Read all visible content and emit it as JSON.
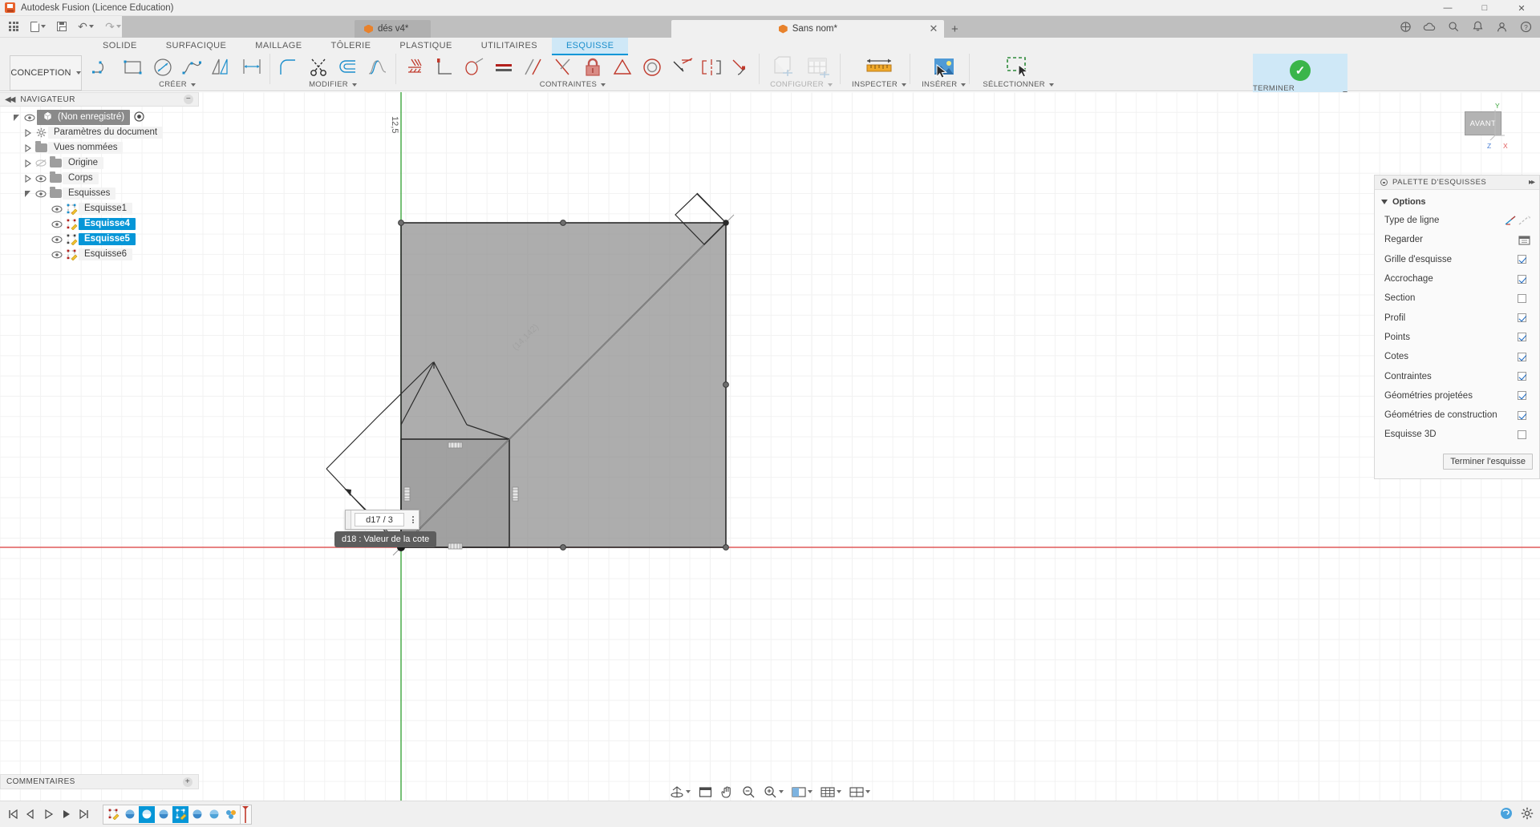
{
  "window": {
    "title": "Autodesk Fusion (Licence Education)",
    "minimize": "—",
    "maximize": "□",
    "close": "✕"
  },
  "quick_access": {
    "grid_icon": "app-grid-icon",
    "new_icon": "new-document-icon",
    "save_icon": "save-icon",
    "undo_icon": "undo-icon",
    "redo_icon": "redo-icon",
    "tabs": [
      {
        "label": "dés v4*",
        "active": false,
        "close": ""
      },
      {
        "label": "Sans nom*",
        "active": true,
        "close": "✕"
      }
    ],
    "new_tab": "+",
    "right_icons": [
      "extensions-icon",
      "cloud-icon",
      "help-search-icon",
      "notifications-icon",
      "account-icon",
      "help-icon"
    ],
    "notification_badge": ""
  },
  "ribbon": {
    "design_dropdown": "CONCEPTION",
    "tabs": [
      {
        "label": "SOLIDE",
        "active": false
      },
      {
        "label": "SURFACIQUE",
        "active": false
      },
      {
        "label": "MAILLAGE",
        "active": false
      },
      {
        "label": "TÔLERIE",
        "active": false
      },
      {
        "label": "PLASTIQUE",
        "active": false
      },
      {
        "label": "UTILITAIRES",
        "active": false
      },
      {
        "label": "ESQUISSE",
        "active": true
      }
    ],
    "groups": [
      {
        "label": "CRÉER",
        "dropdown": true
      },
      {
        "label": "MODIFIER",
        "dropdown": true
      },
      {
        "label": "CONTRAINTES",
        "dropdown": true
      },
      {
        "label": "CONFIGURER",
        "dropdown": true
      },
      {
        "label": "INSPECTER",
        "dropdown": true
      },
      {
        "label": "INSÉRER",
        "dropdown": true
      },
      {
        "label": "SÉLECTIONNER",
        "dropdown": true
      },
      {
        "label": "TERMINER L'ESQUISSE",
        "dropdown": true
      }
    ],
    "create_icons": [
      "line-icon",
      "rectangle-icon",
      "circle-icon",
      "spline-icon",
      "polygon-icon",
      "dimension-icon"
    ],
    "modify_icons": [
      "fillet-icon",
      "trim-icon",
      "offset-icon",
      "curvature-icon"
    ],
    "constraint_icons": [
      "fix-icon",
      "coincident-icon",
      "circular-pattern-icon",
      "equal-icon",
      "parallel-icon",
      "perpendicular-icon",
      "lock-icon",
      "tangent-icon",
      "concentric-icon",
      "collinear-icon",
      "symmetry-icon",
      "smooth-icon"
    ],
    "configure_icons": [
      "configure-body-icon",
      "configure-table-icon"
    ],
    "inspect_icons": [
      "measure-icon"
    ],
    "insert_icons": [
      "insert-image-icon"
    ],
    "select_icons": [
      "select-window-icon"
    ],
    "finish_icon": "finish-sketch-check-icon"
  },
  "navigator": {
    "title": "NAVIGATEUR",
    "collapse_icon": "collapse-left-icon",
    "minimize_icon": "panel-minimize-icon",
    "tree": [
      {
        "label": "(Non enregistré)",
        "indent": 0,
        "state": "selected",
        "icon": "component-icon",
        "eye": true,
        "expander": "open",
        "radio": true
      },
      {
        "label": "Paramètres du document",
        "indent": 1,
        "state": "normal",
        "icon": "gear-icon",
        "eye": false,
        "expander": "closed"
      },
      {
        "label": "Vues nommées",
        "indent": 1,
        "state": "normal",
        "icon": "folder-icon",
        "eye": false,
        "expander": "closed"
      },
      {
        "label": "Origine",
        "indent": 1,
        "state": "normal",
        "icon": "folder-icon",
        "eye": "off",
        "expander": "closed"
      },
      {
        "label": "Corps",
        "indent": 1,
        "state": "normal",
        "icon": "folder-icon",
        "eye": true,
        "expander": "closed"
      },
      {
        "label": "Esquisses",
        "indent": 1,
        "state": "normal",
        "icon": "folder-icon",
        "eye": true,
        "expander": "open"
      },
      {
        "label": "Esquisse1",
        "indent": 2,
        "state": "normal",
        "icon": "sketch-icon",
        "eye": true,
        "expander": "none"
      },
      {
        "label": "Esquisse4",
        "indent": 2,
        "state": "highlighted",
        "icon": "sketch-icon",
        "eye": true,
        "expander": "none"
      },
      {
        "label": "Esquisse5",
        "indent": 2,
        "state": "highlighted",
        "icon": "sketch-icon",
        "eye": true,
        "expander": "none"
      },
      {
        "label": "Esquisse6",
        "indent": 2,
        "state": "normal",
        "icon": "sketch-icon",
        "eye": true,
        "expander": "none"
      }
    ]
  },
  "palette": {
    "title": "PALETTE D'ESQUISSES",
    "expand_icon": "expand-right-icon",
    "section": "Options",
    "rows": [
      {
        "label": "Type de ligne",
        "control": "linetype"
      },
      {
        "label": "Regarder",
        "control": "look-at-button"
      },
      {
        "label": "Grille d'esquisse",
        "control": "checkbox",
        "checked": true
      },
      {
        "label": "Accrochage",
        "control": "checkbox",
        "checked": true
      },
      {
        "label": "Section",
        "control": "checkbox",
        "checked": false
      },
      {
        "label": "Profil",
        "control": "checkbox",
        "checked": true
      },
      {
        "label": "Points",
        "control": "checkbox",
        "checked": true
      },
      {
        "label": "Cotes",
        "control": "checkbox",
        "checked": true
      },
      {
        "label": "Contraintes",
        "control": "checkbox",
        "checked": true
      },
      {
        "label": "Géométries projetées",
        "control": "checkbox",
        "checked": true
      },
      {
        "label": "Géométries de construction",
        "control": "checkbox",
        "checked": true
      },
      {
        "label": "Esquisse 3D",
        "control": "checkbox",
        "checked": false
      }
    ],
    "finish_button": "Terminer l'esquisse"
  },
  "canvas": {
    "viewcube_label": "AVANT",
    "axis_y": "Y",
    "axis_x": "X",
    "axis_z": "Z",
    "vertical_dimension": "12,5",
    "diagonal_dimension": "(14,142)",
    "dimension_input": {
      "value": "d17 / 3",
      "menu_icon": "dimension-options-icon",
      "grip_icon": "drag-grip-icon"
    },
    "tooltip": "d18 : Valeur de la cote"
  },
  "comments": {
    "title": "COMMENTAIRES",
    "add_icon": "add-comment-icon"
  },
  "view_toolbar": {
    "items": [
      {
        "icon": "orbit-icon",
        "dropdown": true
      },
      {
        "icon": "pan-display-icon",
        "dropdown": false
      },
      {
        "icon": "pan-hand-icon",
        "dropdown": false
      },
      {
        "icon": "zoom-icon",
        "dropdown": false
      },
      {
        "icon": "zoom-window-icon",
        "dropdown": true
      },
      {
        "icon": "display-settings-icon",
        "dropdown": true
      },
      {
        "icon": "grid-snap-icon",
        "dropdown": true
      },
      {
        "icon": "viewports-icon",
        "dropdown": true
      }
    ]
  },
  "timeline": {
    "controls": [
      "skip-start-icon",
      "step-back-icon",
      "play-icon",
      "step-forward-icon",
      "skip-end-icon"
    ],
    "features": [
      {
        "icon": "sketch-feature-icon",
        "selected": false
      },
      {
        "icon": "revolve-feature-icon",
        "selected": false
      },
      {
        "icon": "sphere-feature-icon",
        "selected": true
      },
      {
        "icon": "sphere2-feature-icon",
        "selected": false
      },
      {
        "icon": "sketch2-feature-icon",
        "selected": true
      },
      {
        "icon": "sphere3-feature-icon",
        "selected": false
      },
      {
        "icon": "sphere4-feature-icon",
        "selected": false
      },
      {
        "icon": "pattern-feature-icon",
        "selected": false
      }
    ],
    "end_marker": "timeline-end-marker",
    "right_icons": [
      "help-bubble-icon",
      "settings-gear-icon"
    ]
  }
}
